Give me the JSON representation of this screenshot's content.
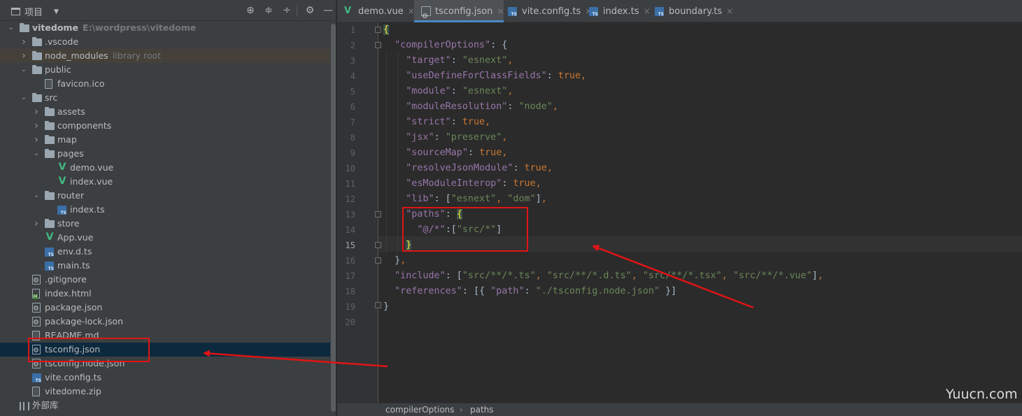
{
  "project_panel": {
    "title": "项目",
    "toolbar_icons": [
      "crosshair-icon",
      "expand-all-icon",
      "collapse-all-icon",
      "gear-icon",
      "minimize-icon"
    ],
    "tree": [
      {
        "label": "vitedome",
        "sub": "E:\\wordpress\\vitedome",
        "type": "folder",
        "expanded": true
      },
      {
        "label": ".vscode",
        "type": "folder",
        "expanded": false
      },
      {
        "label": "node_modules",
        "sub": "library root",
        "type": "folder",
        "expanded": false
      },
      {
        "label": "public",
        "type": "folder",
        "expanded": true
      },
      {
        "label": "favicon.ico",
        "type": "file"
      },
      {
        "label": "src",
        "type": "folder",
        "expanded": true
      },
      {
        "label": "assets",
        "type": "folder",
        "expanded": false
      },
      {
        "label": "components",
        "type": "folder",
        "expanded": false
      },
      {
        "label": "map",
        "type": "folder",
        "expanded": false
      },
      {
        "label": "pages",
        "type": "folder",
        "expanded": true
      },
      {
        "label": "demo.vue",
        "type": "vue"
      },
      {
        "label": "index.vue",
        "type": "vue"
      },
      {
        "label": "router",
        "type": "folder",
        "expanded": true
      },
      {
        "label": "index.ts",
        "type": "ts"
      },
      {
        "label": "store",
        "type": "folder",
        "expanded": false
      },
      {
        "label": "App.vue",
        "type": "vue"
      },
      {
        "label": "env.d.ts",
        "type": "ts"
      },
      {
        "label": "main.ts",
        "type": "ts"
      },
      {
        "label": ".gitignore",
        "type": "config"
      },
      {
        "label": "index.html",
        "type": "html"
      },
      {
        "label": "package.json",
        "type": "config"
      },
      {
        "label": "package-lock.json",
        "type": "config"
      },
      {
        "label": "README.md",
        "type": "file"
      },
      {
        "label": "tsconfig.json",
        "type": "config",
        "selected": true
      },
      {
        "label": "tsconfig.node.json",
        "type": "config"
      },
      {
        "label": "vite.config.ts",
        "type": "ts"
      },
      {
        "label": "vitedome.zip",
        "type": "file"
      },
      {
        "label": "外部库",
        "type": "library"
      }
    ]
  },
  "editor": {
    "tabs": [
      {
        "label": "demo.vue",
        "icon": "vue-icon"
      },
      {
        "label": "tsconfig.json",
        "icon": "config-file-icon",
        "active": true
      },
      {
        "label": "vite.config.ts",
        "icon": "ts-file-icon"
      },
      {
        "label": "index.ts",
        "icon": "ts-file-icon"
      },
      {
        "label": "boundary.ts",
        "icon": "ts-file-icon"
      }
    ],
    "close_glyph": "×",
    "current_line": 15,
    "line_numbers": [
      "1",
      "2",
      "3",
      "4",
      "5",
      "6",
      "7",
      "8",
      "9",
      "10",
      "11",
      "12",
      "13",
      "14",
      "15",
      "16",
      "17",
      "18",
      "19",
      "20"
    ],
    "code": {
      "l1": "{",
      "k_compilerOptions": "\"compilerOptions\"",
      "k_target": "\"target\"",
      "v_target": "\"esnext\"",
      "k_useDefine": "\"useDefineForClassFields\"",
      "v_true": "true",
      "k_module": "\"module\"",
      "v_module": "\"esnext\"",
      "k_moduleResolution": "\"moduleResolution\"",
      "v_moduleResolution": "\"node\"",
      "k_strict": "\"strict\"",
      "k_jsx": "\"jsx\"",
      "v_jsx": "\"preserve\"",
      "k_sourceMap": "\"sourceMap\"",
      "k_resolveJsonModule": "\"resolveJsonModule\"",
      "k_esModuleInterop": "\"esModuleInterop\"",
      "k_lib": "\"lib\"",
      "v_lib1": "\"esnext\"",
      "v_lib2": "\"dom\"",
      "k_paths": "\"paths\"",
      "k_alias": "\"@/*\"",
      "v_alias": "\"src/*\"",
      "k_include": "\"include\"",
      "v_inc1": "\"src/**/*.ts\"",
      "v_inc2": "\"src/**/*.d.ts\"",
      "v_inc3": "\"src/**/*.tsx\"",
      "v_inc4": "\"src/**/*.vue\"",
      "k_references": "\"references\"",
      "k_path": "\"path\"",
      "v_path": "\"./tsconfig.node.json\""
    }
  },
  "breadcrumb": {
    "items": [
      "compilerOptions",
      "paths"
    ],
    "separator": "›"
  },
  "watermark": "Yuucn.com",
  "colors": {
    "annotation": "#e01414",
    "selection": "#0d293e",
    "keyword": "#cc7832",
    "string": "#6a8759",
    "property": "#9876aa"
  }
}
